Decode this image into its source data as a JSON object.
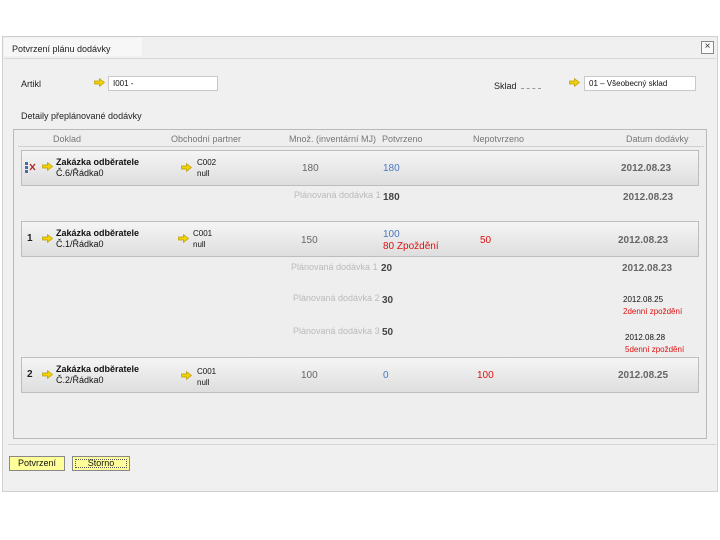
{
  "window": {
    "title": "Potvrzení plánu dodávky",
    "close_glyph": "×"
  },
  "form": {
    "artikl_label": "Artikl",
    "artikl_value": "I001 -",
    "sklad_label": "Sklad",
    "sklad_value": "01 – Všeobecný sklad",
    "section_title": "Detaily přeplánované dodávky"
  },
  "columns": {
    "doklad": "Doklad",
    "partner": "Obchodní partner",
    "mnoz": "Množ. (inventární MJ)",
    "potvrzeno": "Potvrzeno",
    "nepotvrzeno": "Nepotvrzeno",
    "datum": "Datum dodávky"
  },
  "rows": [
    {
      "num": "",
      "doc_title": "Zakázka odběratele",
      "doc_ref": "Č.6/Řádka0",
      "partner_code": "C002",
      "partner_name": "null",
      "qty": "180",
      "confirmed": "180",
      "confirmed_note": "",
      "unconfirmed": "",
      "date": "2012.08.23",
      "plans": [
        {
          "label": "Plánovaná dodávka 1",
          "qty": "180",
          "date": "2012.08.23",
          "delay": ""
        }
      ]
    },
    {
      "num": "1",
      "doc_title": "Zakázka odběratele",
      "doc_ref": "Č.1/Řádka0",
      "partner_code": "C001",
      "partner_name": "null",
      "qty": "150",
      "confirmed": "100",
      "confirmed_note": "80 Zpoždění",
      "unconfirmed": "50",
      "date": "2012.08.23",
      "plans": [
        {
          "label": "Plánovaná dodávka 1",
          "qty": "20",
          "date": "2012.08.23",
          "delay": ""
        },
        {
          "label": "Plánovaná dodávka 2",
          "qty": "30",
          "date": "2012.08.25",
          "delay": "2denní zpoždění"
        },
        {
          "label": "Plánovaná dodávka 3",
          "qty": "50",
          "date": "2012.08.28",
          "delay": "5denní zpoždění"
        }
      ]
    },
    {
      "num": "2",
      "doc_title": "Zakázka odběratele",
      "doc_ref": "Č.2/Řádka0",
      "partner_code": "C001",
      "partner_name": "null",
      "qty": "100",
      "confirmed": "0",
      "confirmed_note": "",
      "unconfirmed": "100",
      "date": "2012.08.25",
      "plans": []
    }
  ],
  "buttons": {
    "confirm": "Potvrzení",
    "cancel": "Storno"
  },
  "colors": {
    "accent_yellow": "#ffff9a",
    "link_arrow": "#f2d20a",
    "confirmed_blue": "#4a78c0",
    "delay_red": "#dd1111"
  }
}
